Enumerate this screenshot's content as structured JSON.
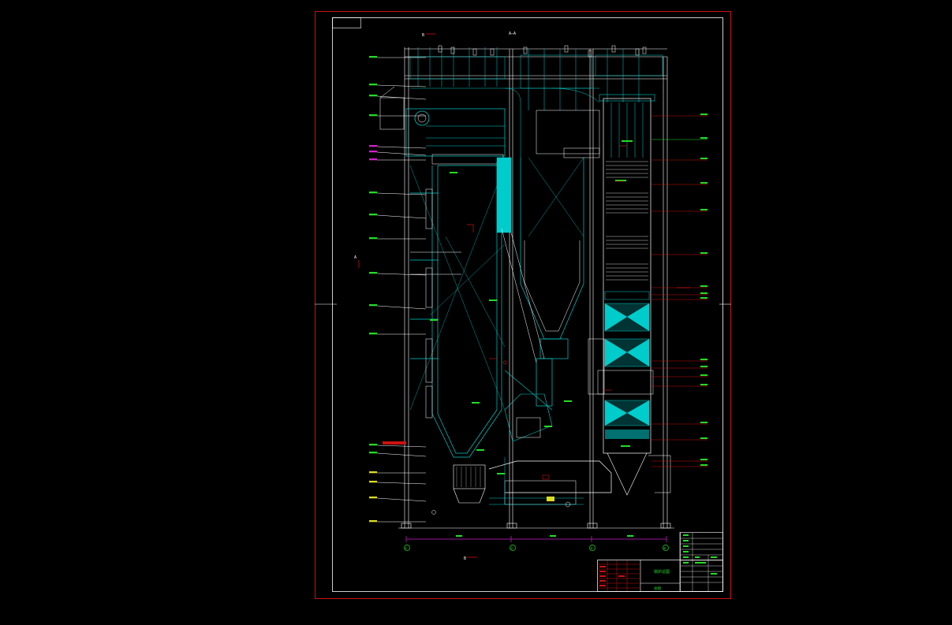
{
  "drawing": {
    "section_label": "A—A",
    "section_marks": [
      "B",
      "B"
    ],
    "axis_letters": [
      "A",
      "A"
    ],
    "grid_labels": [
      "①",
      "②",
      "③",
      "④"
    ],
    "dimension_labels": [
      "",
      "",
      ""
    ],
    "bottom_mark": "B"
  },
  "colors": {
    "background": "#000000",
    "border": "#cc1111",
    "frame": "#ffffff",
    "primary_lines": "#00cccc",
    "secondary_lines": "#ffffff",
    "callouts_left": "#22dd22",
    "callouts_right": "#cc1111",
    "fill_heat": "#00cccc",
    "dimension_line": "#cc22cc",
    "grid_bubble": "#22dd22"
  },
  "title_block": {
    "title": "锅炉总图",
    "sheet": "总图"
  }
}
